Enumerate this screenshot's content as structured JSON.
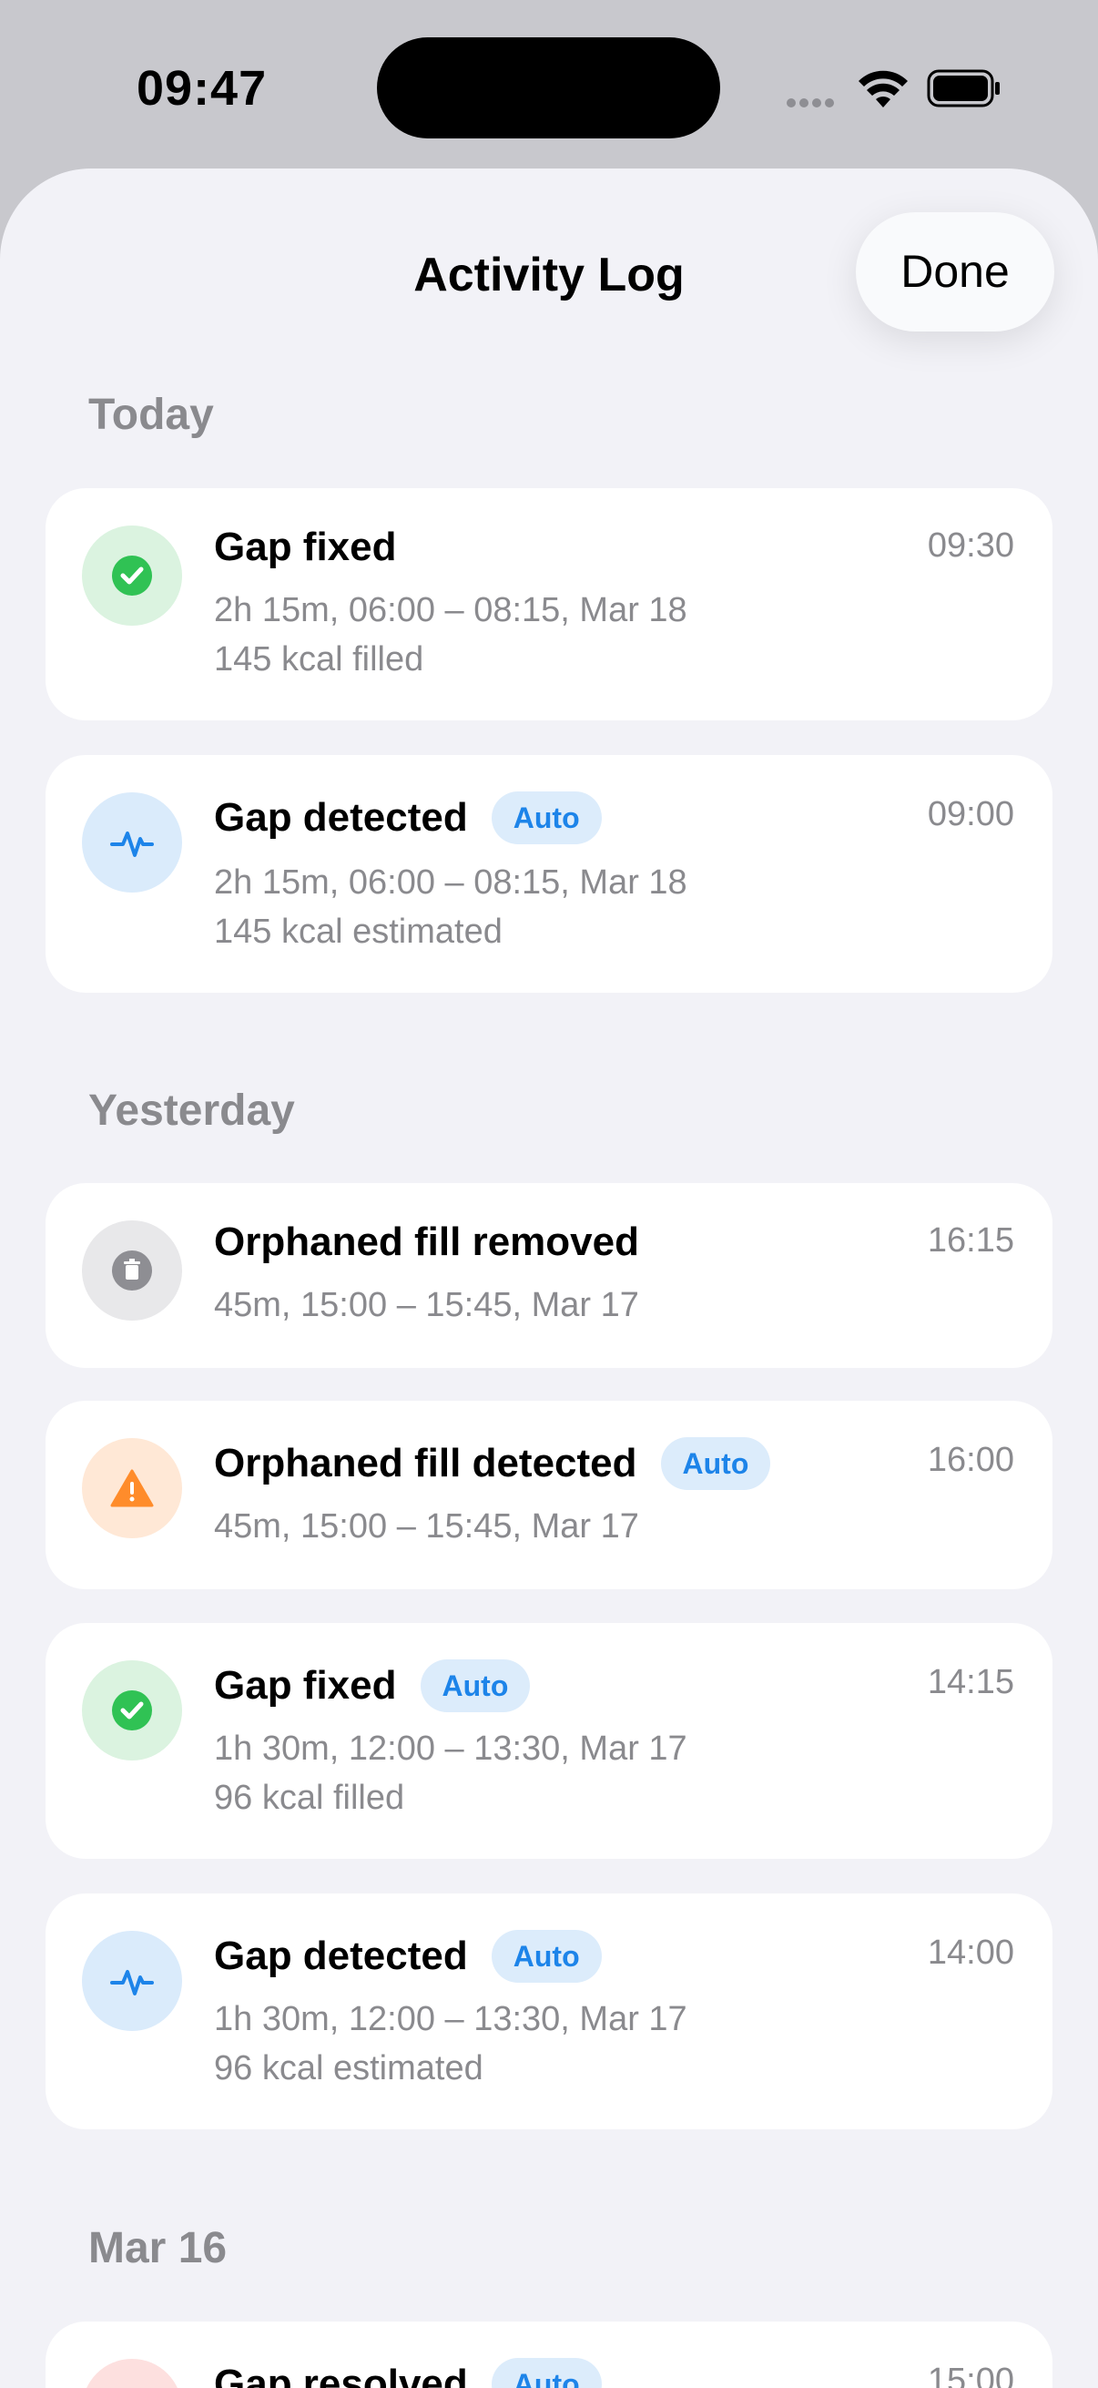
{
  "status_bar": {
    "time": "09:47"
  },
  "header": {
    "title": "Activity Log",
    "done_label": "Done"
  },
  "colors": {
    "accent_blue": "#1d84e9",
    "success_green": "#30c254",
    "warning_orange": "#ff8c2b",
    "neutral_gray": "#8e8e93",
    "error_red": "#ff3b30"
  },
  "sections": [
    {
      "label": "Today",
      "items": [
        {
          "icon": "checkmark-circle-icon",
          "title": "Gap fixed",
          "badge": "",
          "line1": "2h 15m, 06:00 – 08:15, Mar 18",
          "line2": "145 kcal filled",
          "time": "09:30"
        },
        {
          "icon": "heartbeat-icon",
          "title": "Gap detected",
          "badge": "Auto",
          "line1": "2h 15m, 06:00 – 08:15, Mar 18",
          "line2": "145 kcal estimated",
          "time": "09:00"
        }
      ]
    },
    {
      "label": "Yesterday",
      "items": [
        {
          "icon": "trash-icon",
          "title": "Orphaned fill removed",
          "badge": "",
          "line1": "45m, 15:00 – 15:45, Mar 17",
          "line2": "",
          "time": "16:15"
        },
        {
          "icon": "warning-icon",
          "title": "Orphaned fill detected",
          "badge": "Auto",
          "line1": "45m, 15:00 – 15:45, Mar 17",
          "line2": "",
          "time": "16:00"
        },
        {
          "icon": "checkmark-circle-icon",
          "title": "Gap fixed",
          "badge": "Auto",
          "line1": "1h 30m, 12:00 – 13:30, Mar 17",
          "line2": "96 kcal filled",
          "time": "14:15"
        },
        {
          "icon": "heartbeat-icon",
          "title": "Gap detected",
          "badge": "Auto",
          "line1": "1h 30m, 12:00 – 13:30, Mar 17",
          "line2": "96 kcal estimated",
          "time": "14:00"
        }
      ]
    },
    {
      "label": "Mar 16",
      "items": [
        {
          "icon": "resolved-icon",
          "title": "Gap resolved",
          "badge": "Auto",
          "line1": "",
          "line2": "",
          "time": "15:00"
        }
      ]
    }
  ]
}
